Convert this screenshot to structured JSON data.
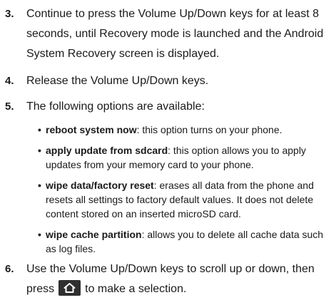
{
  "steps": [
    {
      "number": "3.",
      "text": "Continue to press the Volume Up/Down keys for at least 8 seconds, until Recovery mode is launched and the Android System Recovery screen is displayed."
    },
    {
      "number": "4.",
      "text": "Release the Volume Up/Down keys."
    },
    {
      "number": "5.",
      "text": "The following options are available:"
    },
    {
      "number": "6.",
      "text_before": "Use the Volume Up/Down keys to scroll up or down, then press",
      "text_after": "to make a selection."
    }
  ],
  "options": [
    {
      "term": "reboot system now",
      "description": ": this option turns on your phone."
    },
    {
      "term": "apply update from sdcard",
      "description": ": this option allows you to apply updates from your memory card to your phone."
    },
    {
      "term": "wipe data/factory reset",
      "description": ": erases all data from the phone and resets all settings to factory default values. It does not delete content stored on an inserted microSD card."
    },
    {
      "term": "wipe cache partition",
      "description": ": allows you to delete all cache data such as log files."
    }
  ],
  "bullet_glyph": "•",
  "icons": {
    "home_key": "home-icon"
  },
  "colors": {
    "text": "#1a1a1a",
    "home_key_bg": "#2f2f2f",
    "home_key_glyph": "#ffffff"
  }
}
